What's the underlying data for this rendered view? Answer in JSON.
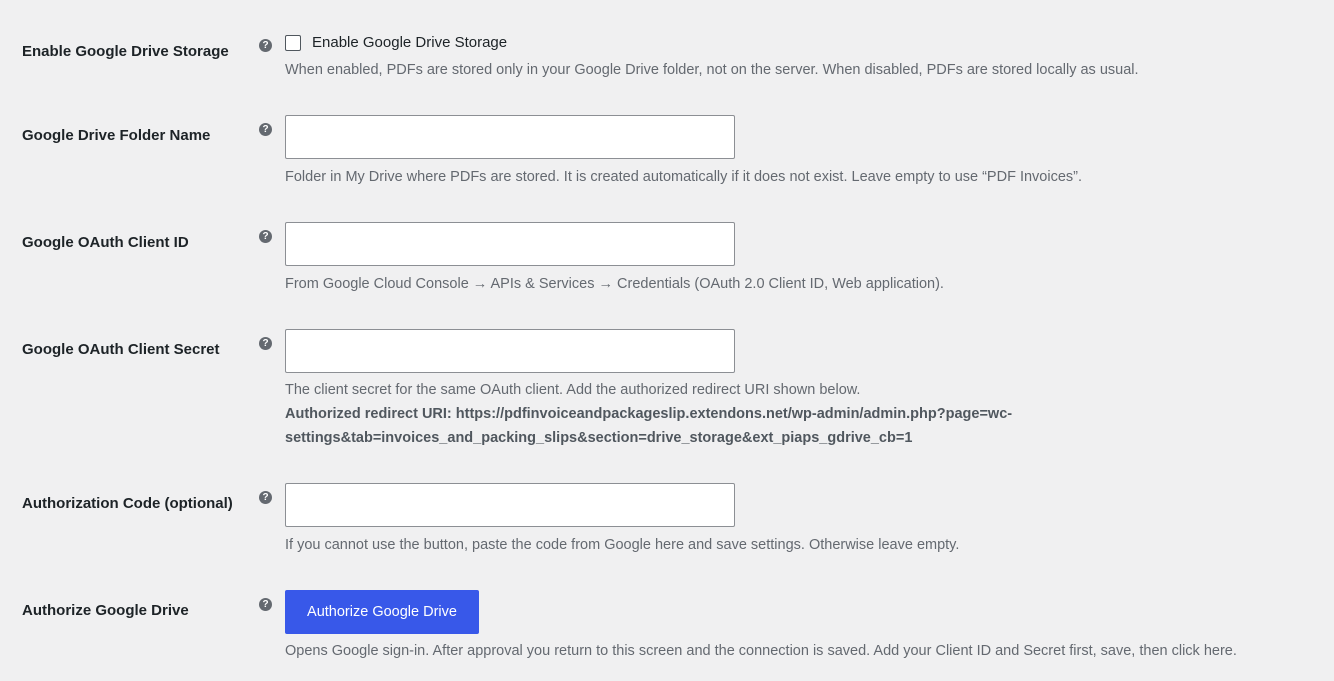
{
  "settings": {
    "enable_storage": {
      "label": "Enable Google Drive Storage",
      "checkbox_label": "Enable Google Drive Storage",
      "checked": false,
      "description": "When enabled, PDFs are stored only in your Google Drive folder, not on the server. When disabled, PDFs are stored locally as usual."
    },
    "folder_name": {
      "label": "Google Drive Folder Name",
      "value": "",
      "description": "Folder in My Drive where PDFs are stored. It is created automatically if it does not exist. Leave empty to use “PDF Invoices”."
    },
    "client_id": {
      "label": "Google OAuth Client ID",
      "value": "",
      "description": "From Google Cloud Console → APIs & Services → Credentials (OAuth 2.0 Client ID, Web application)."
    },
    "client_secret": {
      "label": "Google OAuth Client Secret",
      "value": "",
      "description": "The client secret for the same OAuth client. Add the authorized redirect URI shown below.",
      "redirect_line1": "Authorized redirect URI: https://pdfinvoiceandpackageslip.extendons.net/wp-admin/admin.php?page=wc-",
      "redirect_line2": "settings&tab=invoices_and_packing_slips&section=drive_storage&ext_piaps_gdrive_cb=1"
    },
    "auth_code": {
      "label": "Authorization Code (optional)",
      "value": "",
      "description": "If you cannot use the button, paste the code from Google here and save settings. Otherwise leave empty."
    },
    "authorize": {
      "label": "Authorize Google Drive",
      "button_label": "Authorize Google Drive",
      "button_color": "#3858e9",
      "description": "Opens Google sign-in. After approval you return to this screen and the connection is saved. Add your Client ID and Secret first, save, then click here."
    }
  },
  "help_icon_glyph": "?",
  "colors": {
    "background": "#f0f0f1",
    "label": "#1d2327",
    "description": "#646970"
  }
}
